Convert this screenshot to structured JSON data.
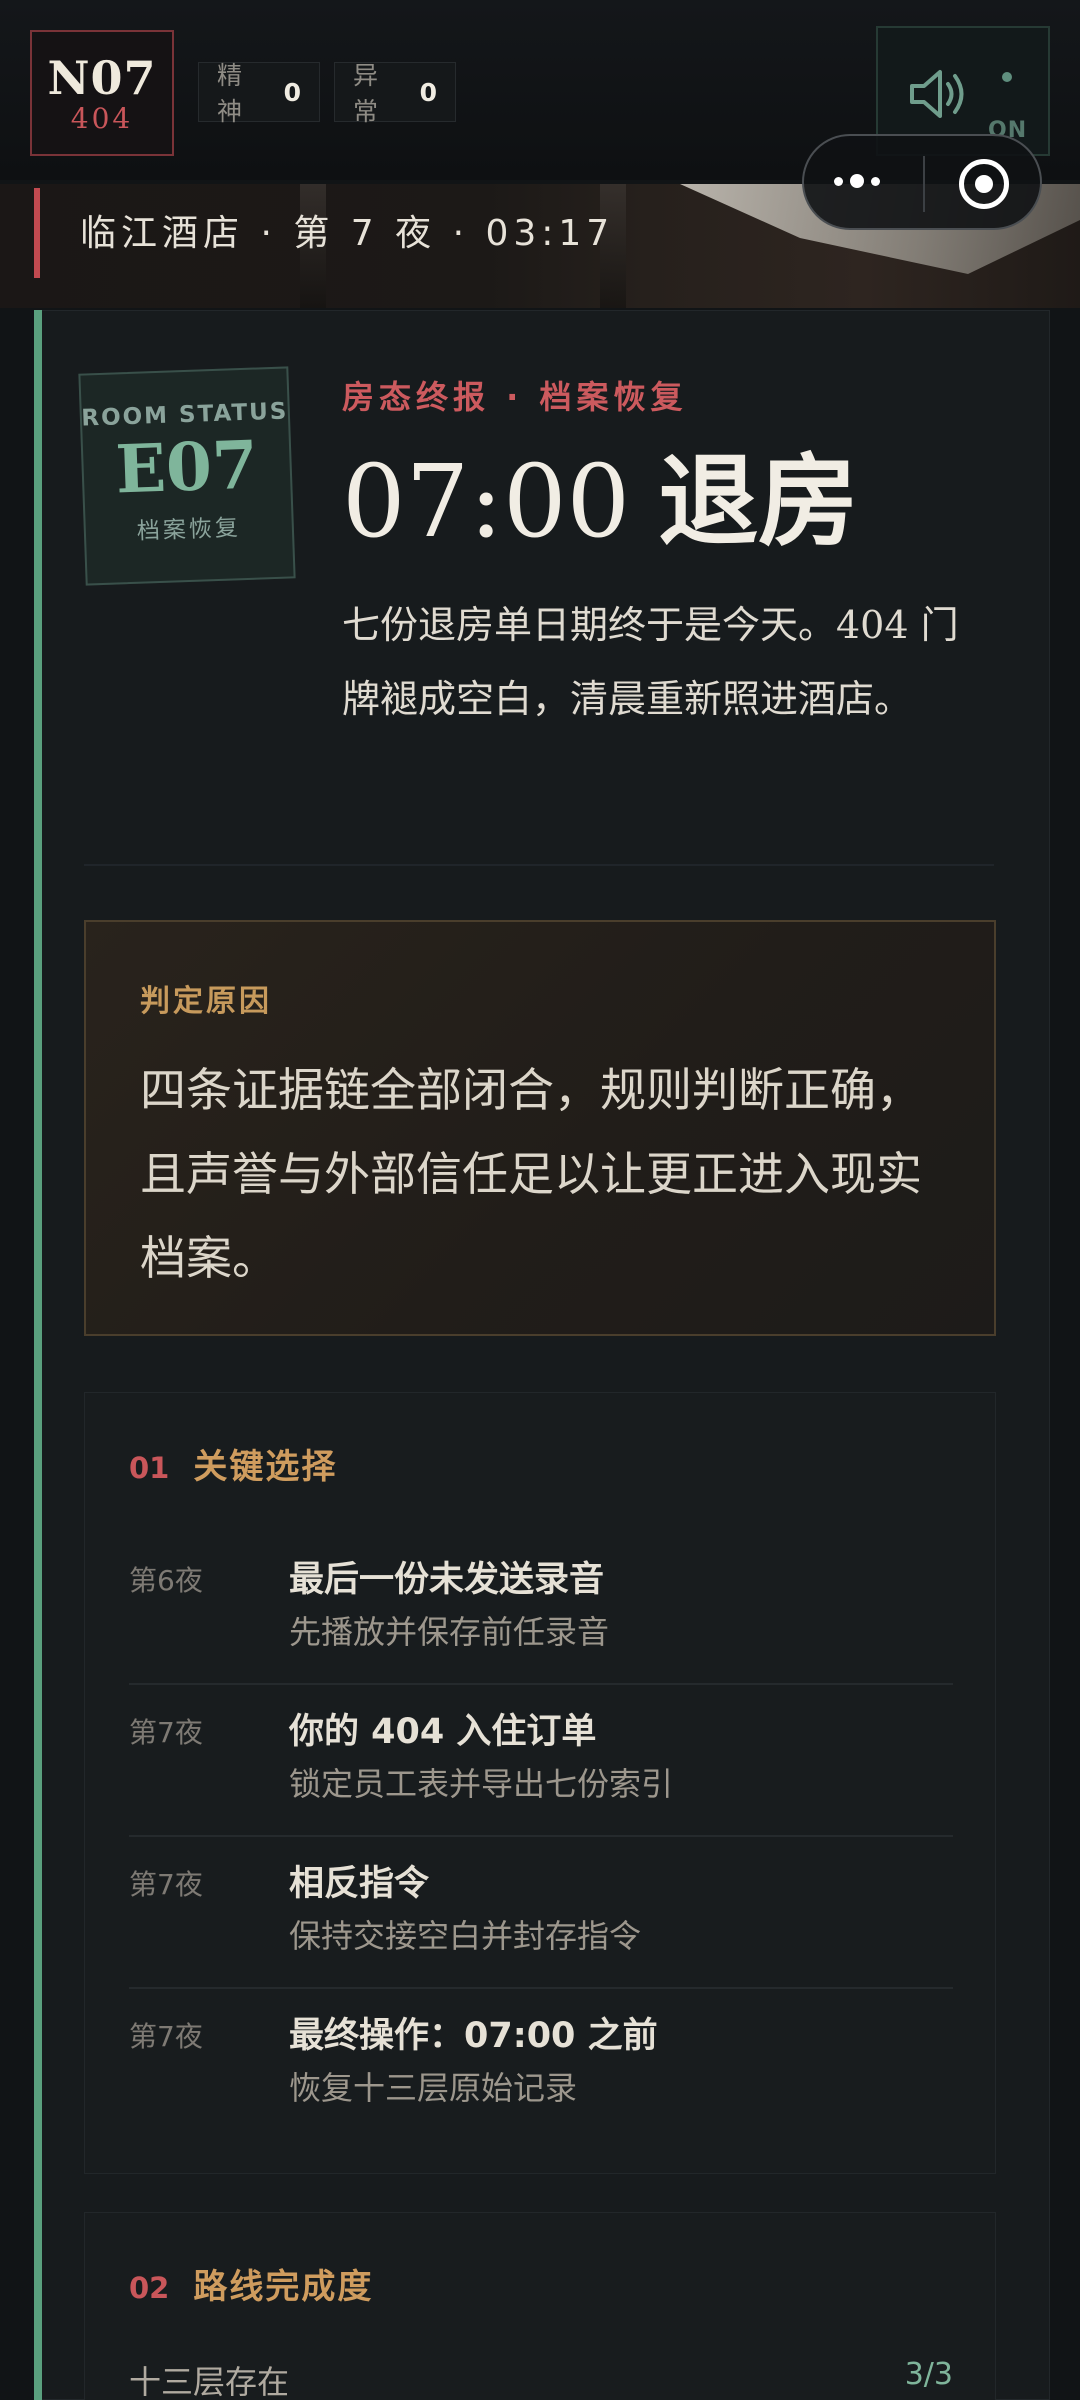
{
  "header": {
    "room_code": "N07",
    "room_number": "404",
    "stats": [
      {
        "label": "精神",
        "value": "0"
      },
      {
        "label": "异常",
        "value": "0"
      }
    ],
    "sound": {
      "icon": "speaker-icon",
      "state": "ON"
    }
  },
  "banner": {
    "location": "临江酒店 · 第 7 夜 · 03:17"
  },
  "status": {
    "stamp_title": "ROOM STATUS",
    "stamp_code": "E07",
    "stamp_sub": "档案恢复",
    "kicker": "房态终报 · 档案恢复",
    "headline_time": "07:00",
    "headline_word": "退房",
    "lede": "七份退房单日期终于是今天。404 门牌褪成空白，清晨重新照进酒店。"
  },
  "verdict": {
    "label": "判定原因",
    "text": "四条证据链全部闭合，规则判断正确，且声誉与外部信任足以让更正进入现实档案。"
  },
  "key_choices": {
    "number": "01",
    "title": "关键选择",
    "items": [
      {
        "night": "第6夜",
        "title": "最后一份未发送录音",
        "desc": "先播放并保存前任录音"
      },
      {
        "night": "第7夜",
        "title": "你的 404 入住订单",
        "desc": "锁定员工表并导出七份索引"
      },
      {
        "night": "第7夜",
        "title": "相反指令",
        "desc": "保持交接空白并封存指令"
      },
      {
        "night": "第7夜",
        "title": "最终操作：07:00 之前",
        "desc": "恢复十三层原始记录"
      }
    ]
  },
  "route": {
    "number": "02",
    "title": "路线完成度",
    "rows": [
      {
        "name": "十三层存在",
        "value": "3/3"
      }
    ]
  },
  "colors": {
    "accent_red": "#c9565a",
    "accent_gold": "#cf9c5e",
    "accent_green": "#7fb59b"
  }
}
